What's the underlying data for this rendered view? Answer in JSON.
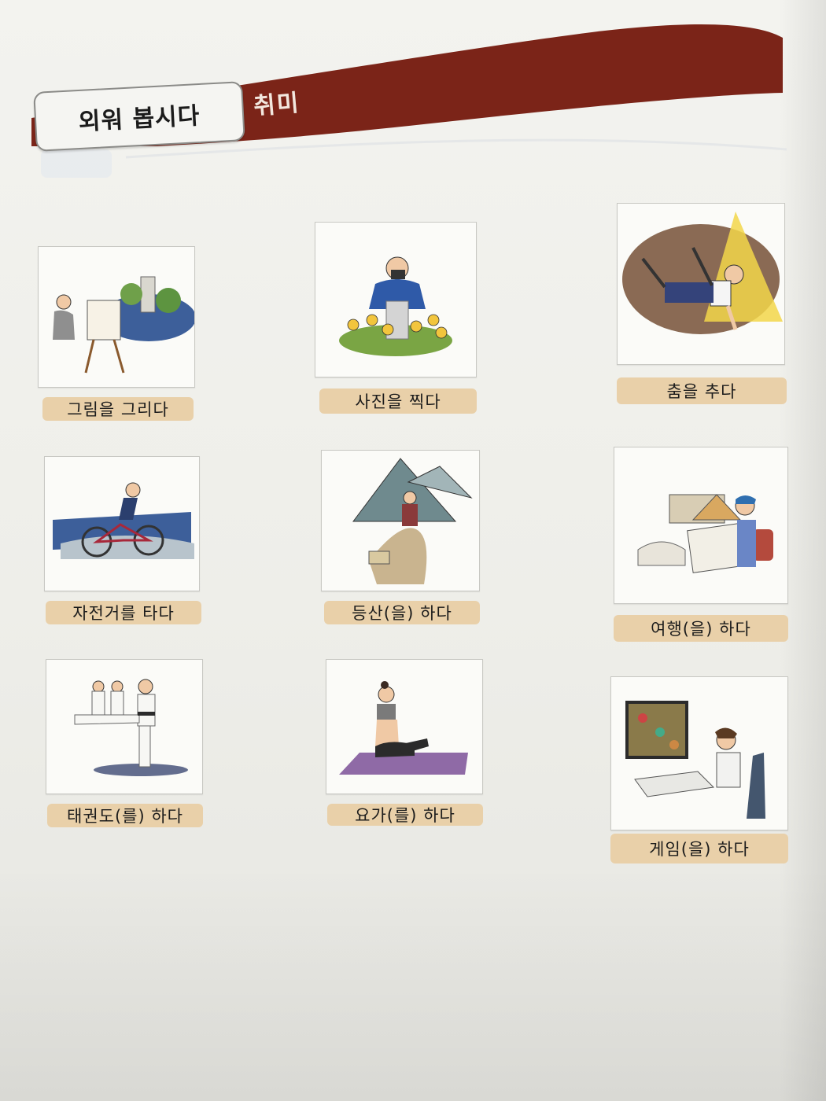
{
  "header": {
    "section_label": "외워 봅시다",
    "topic": "취미",
    "band_color": "#7b2418"
  },
  "hobbies": [
    {
      "label": "그림을 그리다",
      "illustration": "painting-illustration"
    },
    {
      "label": "사진을 찍다",
      "illustration": "photography-illustration"
    },
    {
      "label": "춤을 추다",
      "illustration": "dancing-illustration"
    },
    {
      "label": "자전거를 타다",
      "illustration": "cycling-illustration"
    },
    {
      "label": "등산(을) 하다",
      "illustration": "hiking-illustration"
    },
    {
      "label": "여행(을) 하다",
      "illustration": "travel-illustration"
    },
    {
      "label": "태권도(를) 하다",
      "illustration": "taekwondo-illustration"
    },
    {
      "label": "요가(를) 하다",
      "illustration": "yoga-illustration"
    },
    {
      "label": "게임(을) 하다",
      "illustration": "gaming-illustration"
    }
  ],
  "colors": {
    "label_bg": "#e9d0a9",
    "band": "#7b2418"
  }
}
